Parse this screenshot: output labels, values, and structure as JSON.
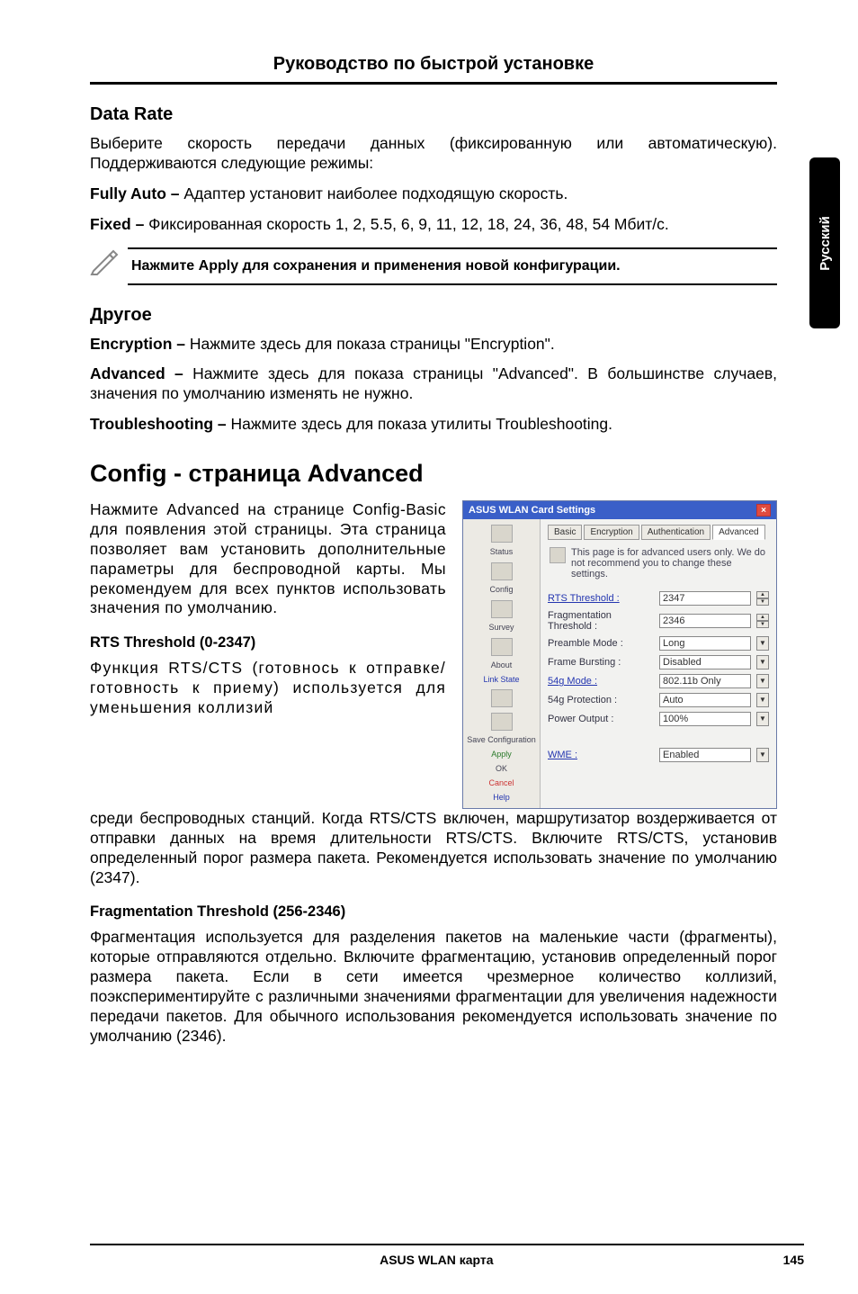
{
  "sidetab": "Русский",
  "header": {
    "title": "Руководство по быстрой установке"
  },
  "s1": {
    "title": "Data Rate",
    "p1": "Выберите скорость передачи данных (фиксированную или автоматическую). Поддерживаются следующие режимы:",
    "p2_label": "Fully Auto – ",
    "p2_text": "Адаптер установит наиболее подходящую скорость.",
    "p3_label": "Fixed – ",
    "p3_text": "Фиксированная скорость 1, 2, 5.5, 6, 9, 11, 12, 18, 24, 36, 48, 54 Мбит/с."
  },
  "note": "Нажмите Apply для сохранения и применения новой конфигурации.",
  "s2": {
    "title": "Другое",
    "p1_label": "Encryption – ",
    "p1_text": "Нажмите здесь для показа страницы \"Encryption\".",
    "p2_label": "Advanced – ",
    "p2_text": "Нажмите здесь для показа страницы \"Advanced\". В большинстве случаев, значения по умолчанию изменять не нужно.",
    "p3_label": "Troubleshooting – ",
    "p3_text": "Нажмите здесь для показа утилиты Troubleshooting."
  },
  "s3": {
    "title": "Config - страница Advanced",
    "intro": "Нажмите Advanced на странице Config-Basic для появления этой страницы. Эта страница позволяет вам установить дополнительные параметры для беспроводной карты. Мы рекомендуем для всех пунктов использовать значения по умолчанию.",
    "h_rts": "RTS Threshold (0-2347)",
    "p_rts1": "Функция RTS/CTS (готовнось к отправке/готовность к приему) используется для уменьшения коллизий",
    "p_rts2": "среди беспроводных станций. Когда RTS/CTS включен, маршрутизатор воздерживается от отправки данных на время длительности RTS/CTS. Включите RTS/CTS, установив определенный порог размера пакета. Рекомендуется использовать значение по умолчанию (2347).",
    "h_frag": "Fragmentation Threshold (256-2346)",
    "p_frag": "Фрагментация используется для разделения пакетов на маленькие части (фрагменты), которые отправляются отдельно. Включите фрагментацию, установив определенный порог размера пакета. Если в сети имеется чрезмерное количество коллизий, поэкспериментируйте с различными значениями фрагментации для увеличения надежности передачи пакетов. Для обычного использования рекомендуется использовать значение по умолчанию (2346)."
  },
  "shot": {
    "title": "ASUS WLAN Card Settings",
    "tabs": [
      "Basic",
      "Encryption",
      "Authentication",
      "Advanced"
    ],
    "hint": "This page is for advanced users only. We do not recommend you to change these settings.",
    "side": [
      {
        "label": "Status"
      },
      {
        "label": "Config"
      },
      {
        "label": "Survey"
      },
      {
        "label": "About"
      },
      {
        "label": "Link State"
      },
      {
        "label": ""
      },
      {
        "label": "Save Configuration"
      },
      {
        "label": "Apply"
      },
      {
        "label": "OK"
      },
      {
        "label": "Cancel"
      },
      {
        "label": "Help"
      }
    ],
    "rows": [
      {
        "label": "RTS Threshold :",
        "value": "2347",
        "ctrl": "spin",
        "link": true
      },
      {
        "label": "Fragmentation Threshold :",
        "value": "2346",
        "ctrl": "spin"
      },
      {
        "label": "Preamble Mode :",
        "value": "Long",
        "ctrl": "dd"
      },
      {
        "label": "Frame Bursting :",
        "value": "Disabled",
        "ctrl": "dd"
      },
      {
        "label": "54g Mode :",
        "value": "802.11b Only",
        "ctrl": "dd",
        "link": true
      },
      {
        "label": "54g Protection :",
        "value": "Auto",
        "ctrl": "dd"
      },
      {
        "label": "Power Output :",
        "value": "100%",
        "ctrl": "dd"
      },
      {
        "label": "WME :",
        "value": "Enabled",
        "ctrl": "dd",
        "link": true
      }
    ]
  },
  "footer": {
    "center": "ASUS WLAN карта",
    "page": "145"
  }
}
